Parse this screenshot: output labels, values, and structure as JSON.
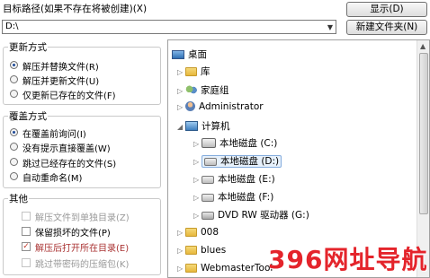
{
  "path": {
    "label": "目标路径(如果不存在将被创建)(X)",
    "value": "D:\\"
  },
  "buttons": {
    "show": "显示(D)",
    "new_folder": "新建文件夹(N)"
  },
  "update_mode": {
    "title": "更新方式",
    "options": [
      {
        "label": "解压并替换文件(R)",
        "selected": true
      },
      {
        "label": "解压并更新文件(U)",
        "selected": false
      },
      {
        "label": "仅更新已存在的文件(F)",
        "selected": false
      }
    ]
  },
  "overwrite_mode": {
    "title": "覆盖方式",
    "options": [
      {
        "label": "在覆盖前询问(I)",
        "selected": true
      },
      {
        "label": "没有提示直接覆盖(W)",
        "selected": false
      },
      {
        "label": "跳过已经存在的文件(S)",
        "selected": false
      },
      {
        "label": "自动重命名(M)",
        "selected": false
      }
    ]
  },
  "misc": {
    "title": "其他",
    "options": [
      {
        "label": "解压文件到单独目录(Z)",
        "checked": false,
        "enabled": false
      },
      {
        "label": "保留损坏的文件(P)",
        "checked": false,
        "enabled": true
      },
      {
        "label": "解压后打开所在目录(E)",
        "checked": true,
        "enabled": true
      },
      {
        "label": "跳过带密码的压缩包(K)",
        "checked": false,
        "enabled": false
      }
    ]
  },
  "tree": {
    "desktop": "桌面",
    "library": "库",
    "homegroup": "家庭组",
    "user": "Administrator",
    "computer": "计算机",
    "drive_c": "本地磁盘 (C:)",
    "drive_d": "本地磁盘 (D:)",
    "drive_e": "本地磁盘 (E:)",
    "drive_f": "本地磁盘 (F:)",
    "drive_g": "DVD RW 驱动器 (G:)",
    "folder_008": "008",
    "folder_blues": "blues",
    "folder_webmaster": "WebmasterTool"
  },
  "watermark": "396网址导航",
  "colors": {
    "accent": "#1f4b99",
    "selection": "#e7f1fb",
    "watermark": "#e4242b",
    "check": "#c0392b"
  }
}
